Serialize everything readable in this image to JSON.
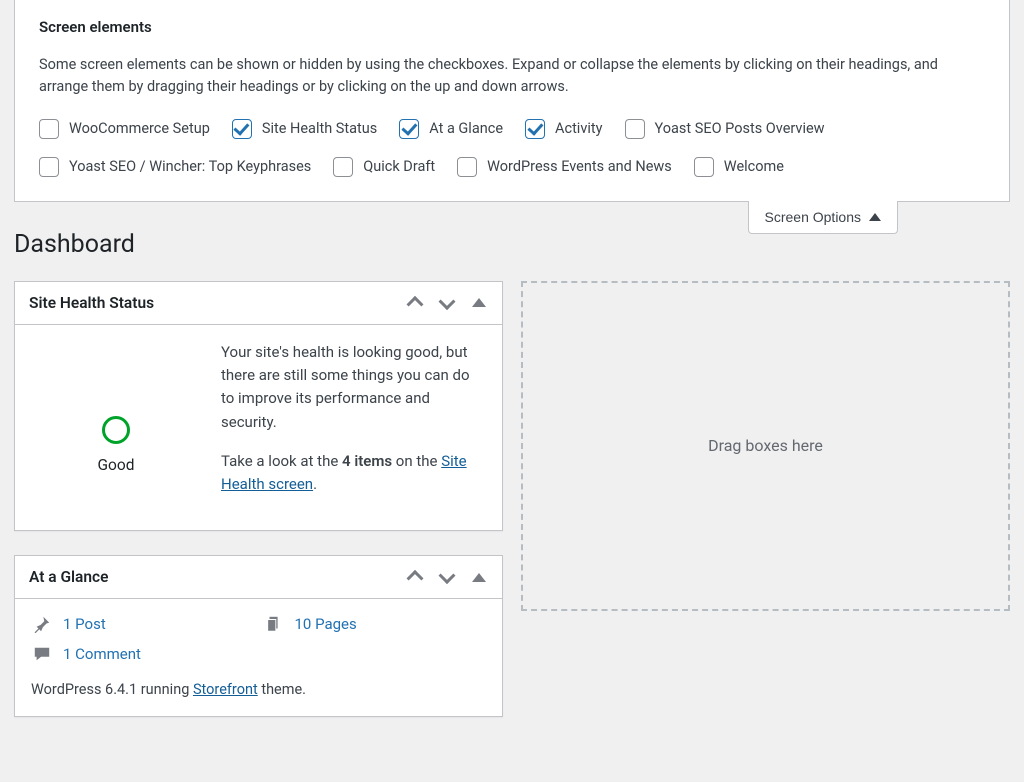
{
  "screenOptions": {
    "heading": "Screen elements",
    "description": "Some screen elements can be shown or hidden by using the checkboxes. Expand or collapse the elements by clicking on their headings, and arrange them by dragging their headings or by clicking on the up and down arrows.",
    "toggleLabel": "Screen Options",
    "items": [
      {
        "label": "WooCommerce Setup",
        "checked": false
      },
      {
        "label": "Site Health Status",
        "checked": true
      },
      {
        "label": "At a Glance",
        "checked": true
      },
      {
        "label": "Activity",
        "checked": true
      },
      {
        "label": "Yoast SEO Posts Overview",
        "checked": false
      },
      {
        "label": "Yoast SEO / Wincher: Top Keyphrases",
        "checked": false
      },
      {
        "label": "Quick Draft",
        "checked": false
      },
      {
        "label": "WordPress Events and News",
        "checked": false
      },
      {
        "label": "Welcome",
        "checked": false
      }
    ]
  },
  "pageTitle": "Dashboard",
  "siteHealth": {
    "title": "Site Health Status",
    "status": "Good",
    "message": "Your site's health is looking good, but there are still some things you can do to improve its performance and security.",
    "cta_prefix": "Take a look at the ",
    "cta_strong": "4 items",
    "cta_mid": " on the ",
    "cta_link": "Site Health screen",
    "cta_suffix": "."
  },
  "atAGlance": {
    "title": "At a Glance",
    "posts": "1 Post",
    "pages": "10 Pages",
    "comments": "1 Comment",
    "footer_prefix": "WordPress 6.4.1 running ",
    "footer_theme": "Storefront",
    "footer_suffix": " theme."
  },
  "dropzone": {
    "label": "Drag boxes here"
  }
}
